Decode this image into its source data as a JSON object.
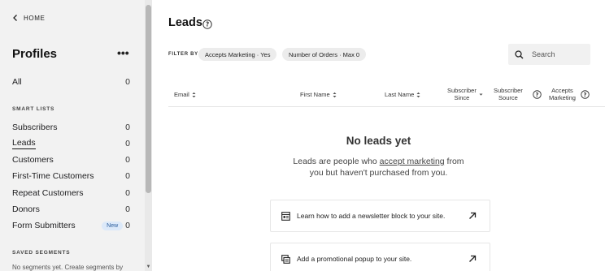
{
  "sidebar": {
    "home_label": "HOME",
    "title": "Profiles",
    "more_label": "•••",
    "all": {
      "label": "All",
      "count": "0"
    },
    "smart_lists_heading": "SMART LISTS",
    "items": [
      {
        "label": "Subscribers",
        "count": "0"
      },
      {
        "label": "Leads",
        "count": "0"
      },
      {
        "label": "Customers",
        "count": "0"
      },
      {
        "label": "First-Time Customers",
        "count": "0"
      },
      {
        "label": "Repeat Customers",
        "count": "0"
      },
      {
        "label": "Donors",
        "count": "0"
      },
      {
        "label": "Form Submitters",
        "count": "0",
        "badge": "New"
      }
    ],
    "saved_segments_heading": "SAVED SEGMENTS",
    "saved_segments_note": "No segments yet. Create segments by"
  },
  "main": {
    "title": "Leads",
    "filter_label": "FILTER BY",
    "filters": [
      "Accepts Marketing · Yes",
      "Number of Orders · Max 0"
    ],
    "search_placeholder": "Search",
    "columns": {
      "email": "Email",
      "first_name": "First Name",
      "last_name": "Last Name",
      "subscriber_since_1": "Subscriber",
      "subscriber_since_2": "Since",
      "subscriber_source_1": "Subscriber",
      "subscriber_source_2": "Source",
      "accepts_marketing_1": "Accepts",
      "accepts_marketing_2": "Marketing"
    },
    "empty": {
      "title": "No leads yet",
      "desc_pre": "Leads are people who ",
      "desc_link": "accept marketing",
      "desc_post": " from",
      "desc_line2": "you but haven't purchased from you."
    },
    "cards": [
      {
        "label": "Learn how to add a newsletter block to your site."
      },
      {
        "label": "Add a promotional popup to your site."
      }
    ]
  }
}
